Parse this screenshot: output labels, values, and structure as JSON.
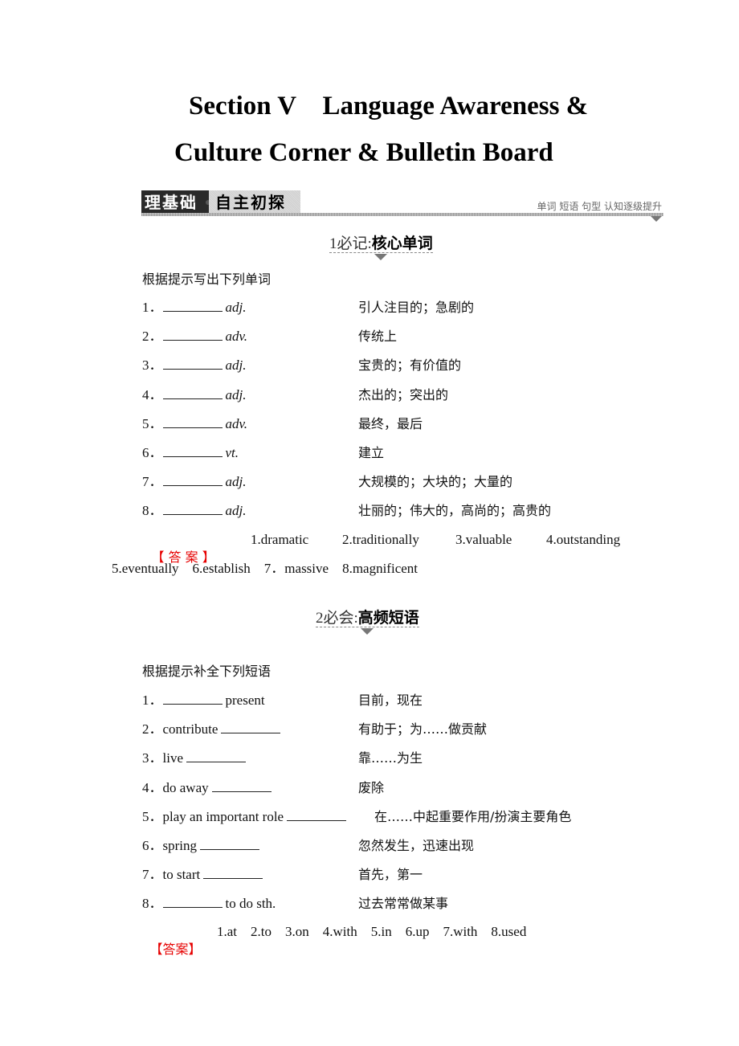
{
  "title": {
    "line1": "Section V    Language Awareness &",
    "line2": "Culture Corner & Bulletin Board"
  },
  "section_bar": {
    "dark_label": "理基础",
    "light_label": "自主初探",
    "tagline": "单词 短语 句型  认知逐级提升",
    "separator_icon": "dot-icon",
    "arrow_icon": "triangle-down-icon"
  },
  "part1": {
    "heading_prefix": "1必记:",
    "heading": "核心单词",
    "instruction": "根据提示写出下列单词",
    "items": [
      {
        "num": "1．",
        "pos": "adj.",
        "meaning": "引人注目的；急剧的"
      },
      {
        "num": "2．",
        "pos": "adv.",
        "meaning": "传统上"
      },
      {
        "num": "3．",
        "pos": "adj.",
        "meaning": "宝贵的；有价值的"
      },
      {
        "num": "4．",
        "pos": "adj.",
        "meaning": "杰出的；突出的"
      },
      {
        "num": "5．",
        "pos": "adv.",
        "meaning": "最终，最后"
      },
      {
        "num": "6．",
        "pos": "vt.",
        "meaning": "建立"
      },
      {
        "num": "7．",
        "pos": "adj.",
        "meaning": "大规模的；大块的；大量的"
      },
      {
        "num": "8．",
        "pos": "adj.",
        "meaning": "壮丽的；伟大的，高尚的；高贵的"
      }
    ],
    "answer_label": "【 答 案 】",
    "answers_line1": [
      "1.dramatic",
      "2.traditionally",
      "3.valuable",
      "4.outstanding"
    ],
    "answers_line2": "5.eventually    6.establish    7．massive    8.magnificent"
  },
  "part2": {
    "heading_prefix": "2必会:",
    "heading": "高频短语",
    "instruction": "根据提示补全下列短语",
    "items": [
      {
        "num": "1．",
        "before": "",
        "after": "present",
        "meaning": "目前，现在"
      },
      {
        "num": "2．",
        "before": "contribute",
        "after": "",
        "meaning": "有助于；为……做贡献"
      },
      {
        "num": "3．",
        "before": "live",
        "after": "",
        "meaning": "靠……为生"
      },
      {
        "num": "4．",
        "before": "do away",
        "after": "",
        "meaning": "废除"
      },
      {
        "num": "5．",
        "before": "play an important role",
        "after": "",
        "meaning": "在……中起重要作用/扮演主要角色"
      },
      {
        "num": "6．",
        "before": "spring",
        "after": "",
        "meaning": "忽然发生，迅速出现"
      },
      {
        "num": "7．",
        "before": "to start",
        "after": "",
        "meaning": "首先，第一"
      },
      {
        "num": "8．",
        "before": "",
        "after": "to do sth.",
        "meaning": "过去常常做某事"
      }
    ],
    "answer_label": "【答案】",
    "answers": "1.at    2.to    3.on    4.with    5.in    6.up    7.with    8.used"
  },
  "colors": {
    "answer_label": "#e60000",
    "bar_dark": "#2a2a2a",
    "bar_light": "#d4d4d4"
  }
}
